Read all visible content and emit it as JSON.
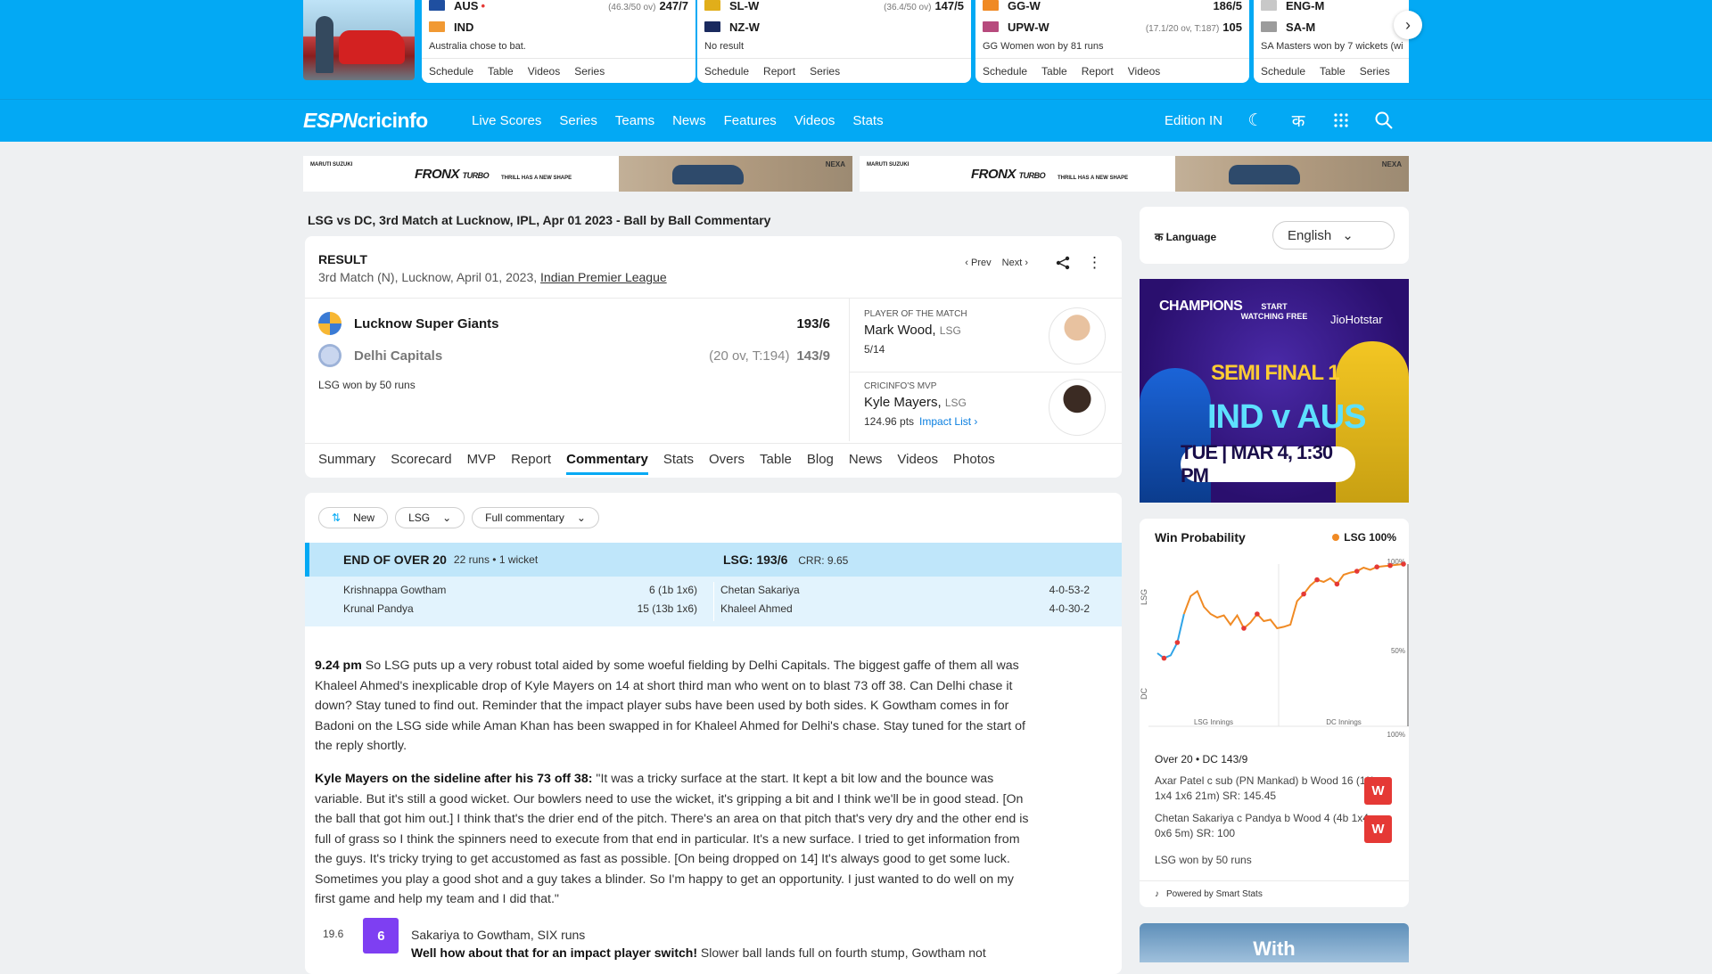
{
  "ticker": {
    "cards": [
      {
        "team1": "AUS",
        "team1_flag": "#1f4fa0",
        "team1_live": true,
        "team1_overs": "(46.3/50 ov)",
        "team1_score": "247/7",
        "team2": "IND",
        "team2_flag": "#f19933",
        "team2_overs": "",
        "team2_score": "",
        "status": "Australia chose to bat.",
        "links": [
          "Schedule",
          "Table",
          "Videos",
          "Series"
        ]
      },
      {
        "team1": "SL-W",
        "team1_flag": "#e1ae1a",
        "team1_overs": "(36.4/50 ov)",
        "team1_score": "147/5",
        "team2": "NZ-W",
        "team2_flag": "#1a2a5e",
        "team2_overs": "",
        "team2_score": "",
        "status": "No result",
        "links": [
          "Schedule",
          "Report",
          "Series"
        ]
      },
      {
        "team1": "GG-W",
        "team1_flag": "#f08a24",
        "team1_overs": "",
        "team1_score": "186/5",
        "team2": "UPW-W",
        "team2_flag": "#b74a7d",
        "team2_overs": "(17.1/20 ov, T:187)",
        "team2_score": "105",
        "status": "GG Women won by 81 runs",
        "links": [
          "Schedule",
          "Table",
          "Report",
          "Videos"
        ]
      },
      {
        "team1": "ENG-M",
        "team1_flag": "#c8c8c8",
        "team1_overs": "",
        "team1_score": "",
        "team2": "SA-M",
        "team2_flag": "#9b9b9b",
        "team2_overs": "",
        "team2_score": "",
        "status": "SA Masters won by 7 wickets (wi",
        "links": [
          "Schedule",
          "Table",
          "Series"
        ]
      }
    ],
    "next_icon": "chevron-right-icon"
  },
  "nav": {
    "logo_espn": "ESPN",
    "logo_cricinfo": "cricinfo",
    "links": [
      "Live Scores",
      "Series",
      "Teams",
      "News",
      "Features",
      "Videos",
      "Stats"
    ],
    "edition": "Edition IN",
    "hindi": "क",
    "icons": [
      "moon-icon",
      "hindi-language-icon",
      "apps-grid-icon",
      "search-icon"
    ]
  },
  "banner": {
    "brand": "MARUTI SUZUKI",
    "model": "FRONX",
    "model_sub": "TURBO",
    "tagline": "THRILL HAS A NEW SHAPE",
    "nexa": "NEXA"
  },
  "page_title": "LSG vs DC, 3rd Match at Lucknow, IPL, Apr 01 2023 - Ball by Ball Commentary",
  "result": {
    "heading": "RESULT",
    "sub_prefix": "3rd Match (N), Lucknow, April 01, 2023,",
    "series_link": "Indian Premier League",
    "prev": "Prev",
    "next": "Next",
    "teams": [
      {
        "name": "Lucknow Super Giants",
        "overs": "",
        "score": "193/6",
        "logo_color": "#3a7bd5"
      },
      {
        "name": "Delhi Capitals",
        "overs": "(20 ov, T:194)",
        "score": "143/9",
        "logo_color": "#9cb2d8"
      }
    ],
    "won_text": "LSG won by 50 runs",
    "potm": {
      "label": "PLAYER OF THE MATCH",
      "name": "Mark Wood",
      "team": "LSG",
      "stat": "5/14"
    },
    "mvp": {
      "label": "CRICINFO'S MVP",
      "name": "Kyle Mayers",
      "team": "LSG",
      "stat": "124.96 pts",
      "link": "Impact List"
    },
    "tabs": [
      "Summary",
      "Scorecard",
      "MVP",
      "Report",
      "Commentary",
      "Stats",
      "Overs",
      "Table",
      "Blog",
      "News",
      "Videos",
      "Photos"
    ],
    "active_tab": "Commentary"
  },
  "commentary": {
    "filters": [
      {
        "label": "New",
        "icon": "sort-icon"
      },
      {
        "label": "LSG",
        "icon": "chevron-down-icon"
      },
      {
        "label": "Full commentary",
        "icon": "chevron-down-icon"
      }
    ],
    "over_summary": {
      "title": "END OF OVER 20",
      "runs": "22 runs • 1 wicket",
      "team_score": "LSG: 193/6",
      "crr": "CRR: 9.65",
      "batters": [
        {
          "name": "Krishnappa Gowtham",
          "stat": "6 (1b 1x6)"
        },
        {
          "name": "Krunal Pandya",
          "stat": "15 (13b 1x6)"
        }
      ],
      "bowlers": [
        {
          "name": "Chetan Sakariya",
          "stat": "4-0-53-2"
        },
        {
          "name": "Khaleel Ahmed",
          "stat": "4-0-30-2"
        }
      ]
    },
    "entries": [
      {
        "time": "9.24 pm",
        "text": "So LSG puts up a very robust total aided by some woeful fielding by Delhi Capitals. The biggest gaffe of them all was Khaleel Ahmed's inexplicable drop of Kyle Mayers on 14 at short third man who went on to blast 73 off 38. Can Delhi chase it down? Stay tuned to find out. Reminder that the impact player subs have been used by both sides. K Gowtham comes in for Badoni on the LSG side while Aman Khan has been swapped in for Khaleel Ahmed for Delhi's chase. Stay tuned for the start of the reply shortly."
      },
      {
        "time": "Kyle Mayers on the sideline after his 73 off 38:",
        "text": "\"It was a tricky surface at the start. It kept a bit low and the bounce was variable. But it's still a good wicket. Our bowlers need to use the wicket, it's gripping a bit and I think we'll be in good stead. [On the ball that got him out.] I think that's the drier end of the pitch. There's an area on that pitch that's very dry and the other end is full of grass so I think the spinners need to execute from that end in particular. It's a new surface. I tried to get information from the guys. It's tricky trying to get accustomed as fast as possible. [On being dropped on 14] It's always good to get some luck. Sometimes you play a good shot and a guy takes a blinder. So I'm happy to get an opportunity. I just wanted to do well on my first game and help my team and I did that.\""
      }
    ],
    "ball": {
      "number": "19.6",
      "runs": "6",
      "headline": "Sakariya to Gowtham, SIX runs",
      "bold": "Well how about that for an impact player switch!",
      "text": "Slower ball lands full on fourth stump, Gowtham not"
    }
  },
  "sidebar": {
    "language_label": "Language",
    "language_value": "English",
    "promo": {
      "champions": "CHAMPIONS",
      "start_watching": "START WATCHING FREE",
      "jiohotstar": "JioHotstar",
      "semi_final": "SEMI FINAL 1",
      "matchup": "IND v AUS",
      "date": "TUE | MAR 4, 1:30 PM"
    },
    "win_prob": {
      "title": "Win Probability",
      "legend": "LSG 100%",
      "over_label": "Over 20 • DC 143/9",
      "wickets": [
        {
          "text": "Axar Patel c sub (PN Mankad) b Wood 16 (11b 1x4 1x6 21m) SR: 145.45",
          "badge": "W"
        },
        {
          "text": "Chetan Sakariya c Pandya b Wood 4 (4b 1x4 0x6 5m) SR: 100",
          "badge": "W"
        }
      ],
      "result": "LSG won by 50 runs",
      "footer": "Powered by Smart Stats"
    },
    "bottom_ad": "With"
  },
  "chart_data": {
    "type": "line",
    "title": "Win Probability",
    "ylabel_top": "LSG",
    "ylabel_bottom": "DC",
    "x_labels": [
      "LSG Innings",
      "DC Innings"
    ],
    "y_ticks": [
      "100%",
      "50%",
      "100%"
    ],
    "ylim": [
      -100,
      100
    ],
    "series": [
      {
        "name": "LSG",
        "color": "#f08a24",
        "values": [
          -25,
          -32,
          -28,
          -10,
          30,
          55,
          62,
          40,
          30,
          25,
          28,
          15,
          28,
          10,
          18,
          30,
          20,
          22,
          10,
          12,
          15,
          48,
          58,
          70,
          78,
          75,
          80,
          72,
          85,
          88,
          90,
          95,
          92,
          96,
          97,
          98,
          99,
          100
        ]
      }
    ],
    "dc_segment_end_index": 4,
    "wicket_markers_idx": [
      1,
      3,
      13,
      15,
      22,
      24,
      27,
      30,
      33,
      35,
      37
    ]
  }
}
